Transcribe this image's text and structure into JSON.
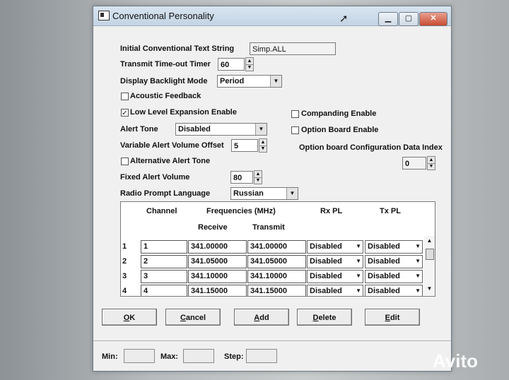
{
  "window": {
    "title": "Conventional Personality"
  },
  "fields": {
    "initial_text_label": "Initial Conventional Text String",
    "initial_text_value": "Simp.ALL",
    "tot_label": "Transmit Time-out Timer",
    "tot_value": "60",
    "backlight_label": "Display Backlight Mode",
    "backlight_value": "Period",
    "acoustic_label": "Acoustic Feedback",
    "acoustic_checked": "",
    "lowlevel_label": "Low Level Expansion Enable",
    "lowlevel_checked": "✓",
    "companding_label": "Companding Enable",
    "optionboard_label": "Option Board Enable",
    "alert_tone_label": "Alert Tone",
    "alert_tone_value": "Disabled",
    "var_vol_label": "Variable Alert Volume Offset",
    "var_vol_value": "5",
    "opt_cfg_label": "Option board Configuration Data Index",
    "opt_cfg_value": "0",
    "alt_alert_label": "Alternative Alert Tone",
    "fixed_vol_label": "Fixed Alert Volume",
    "fixed_vol_value": "80",
    "prompt_lang_label": "Radio Prompt Language",
    "prompt_lang_value": "Russian"
  },
  "table": {
    "headers": {
      "channel": "Channel",
      "frequencies": "Frequencies (MHz)",
      "rx_pl": "Rx PL",
      "tx_pl": "Tx PL",
      "receive": "Receive",
      "transmit": "Transmit"
    },
    "rows": [
      {
        "num": "1",
        "channel": "1",
        "rx": "341.00000",
        "tx": "341.00000",
        "rxpl": "Disabled",
        "txpl": "Disabled"
      },
      {
        "num": "2",
        "channel": "2",
        "rx": "341.05000",
        "tx": "341.05000",
        "rxpl": "Disabled",
        "txpl": "Disabled"
      },
      {
        "num": "3",
        "channel": "3",
        "rx": "341.10000",
        "tx": "341.10000",
        "rxpl": "Disabled",
        "txpl": "Disabled"
      },
      {
        "num": "4",
        "channel": "4",
        "rx": "341.15000",
        "tx": "341.15000",
        "rxpl": "Disabled",
        "txpl": "Disabled"
      }
    ]
  },
  "buttons": {
    "ok_u": "O",
    "ok_rest": "K",
    "cancel_u": "C",
    "cancel_rest": "ancel",
    "add_u": "A",
    "add_rest": "dd",
    "delete_u": "D",
    "delete_rest": "elete",
    "edit_u": "E",
    "edit_rest": "dit"
  },
  "status": {
    "min_label": "Min:",
    "max_label": "Max:",
    "step_label": "Step:"
  },
  "watermark": "Avito"
}
